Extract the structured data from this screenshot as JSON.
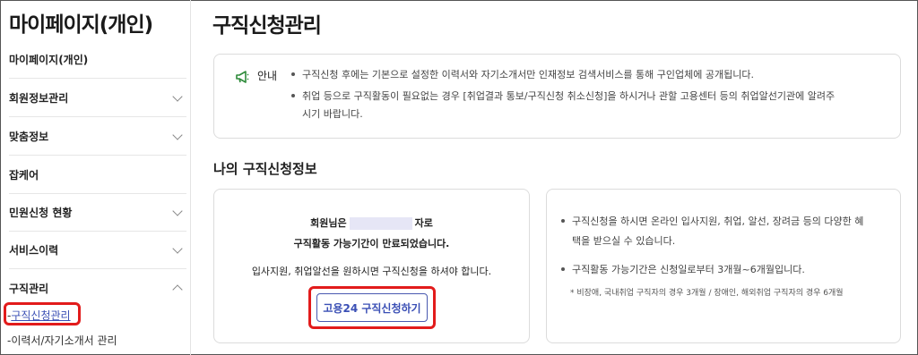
{
  "sidebar": {
    "title": "마이페이지(개인)",
    "items": [
      {
        "label": "마이페이지(개인)",
        "chevron": "none"
      },
      {
        "label": "회원정보관리",
        "chevron": "down"
      },
      {
        "label": "맞춤정보",
        "chevron": "down"
      },
      {
        "label": "잡케어",
        "chevron": "none"
      },
      {
        "label": "민원신청 현황",
        "chevron": "down"
      },
      {
        "label": "서비스이력",
        "chevron": "down"
      },
      {
        "label": "구직관리",
        "chevron": "up"
      }
    ],
    "subitems": [
      {
        "label": "구직신청관리",
        "prefix": "-",
        "active": true
      },
      {
        "label": "이력서/자기소개서 관리",
        "prefix": "-",
        "active": false
      }
    ]
  },
  "main": {
    "title": "구직신청관리",
    "notice": {
      "label": "안내",
      "icon": "megaphone-icon",
      "lines": [
        "구직신청 후에는 기본으로 설정한 이력서와 자기소개서만 인재정보 검색서비스를 통해 구인업체에 공개됩니다.",
        "취업 등으로 구직활동이 필요없는 경우 [취업결과 통보/구직신청 취소신청]을 하시거나 관할 고용센터 등의 취업알선기관에 알려주",
        "시기 바랍니다."
      ]
    },
    "section_title": "나의 구직신청정보",
    "status_card": {
      "line1_prefix": "회원님은",
      "line1_suffix": "자로",
      "line2": "구직활동 가능기간이 만료되었습니다.",
      "line3": "입사지원, 취업알선을 원하시면 구직신청을 하셔야 합니다.",
      "button_label": "고용24 구직신청하기"
    },
    "info_card": {
      "lines": [
        "구직신청을 하시면 온라인 입사지원, 취업, 알선, 장려금 등의 다양한 혜",
        "택을 받으실 수 있습니다.",
        "구직활동 가능기간은 신청일로부터 3개월~6개월입니다."
      ],
      "note": "* 비장애, 국내취업 구직자의 경우 3개월 / 장애인, 해외취업 구직자의 경우 6개월"
    }
  },
  "colors": {
    "accent": "#3a4fb5",
    "highlight": "#e21b1b",
    "notice_icon": "#2e8b3a"
  }
}
